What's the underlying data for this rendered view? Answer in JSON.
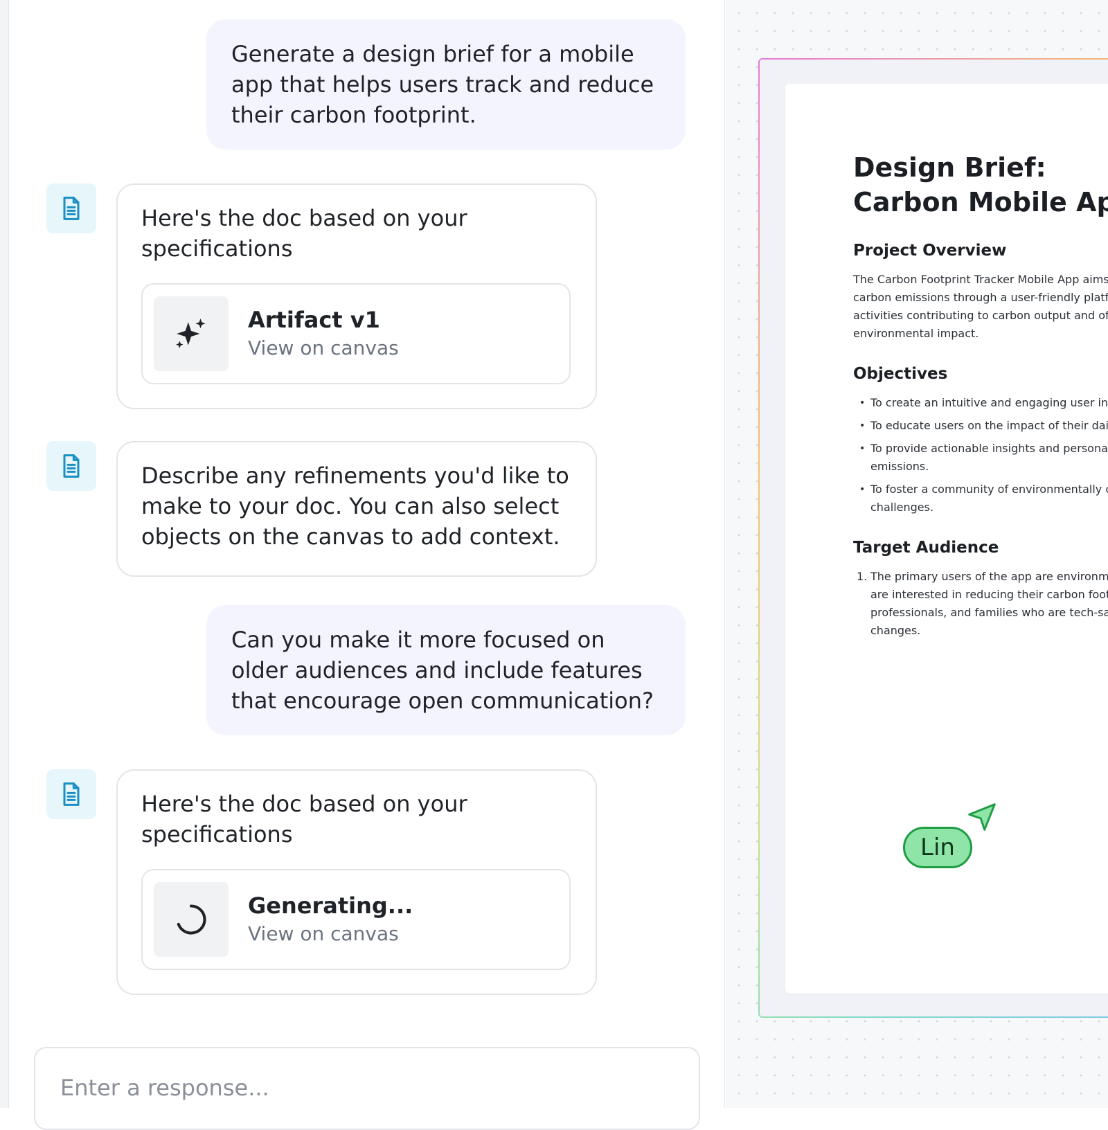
{
  "chat": {
    "messages": [
      {
        "role": "user",
        "text": "Generate a design brief for a mobile app that helps users track and reduce their carbon footprint."
      },
      {
        "role": "assistant",
        "icon": "document-icon",
        "text": "Here's the doc based on your specifications",
        "artifact": {
          "icon": "sparkles-icon",
          "title": "Artifact v1",
          "link": "View on canvas"
        }
      },
      {
        "role": "assistant",
        "icon": "document-icon",
        "text": "Describe any refinements you'd like to make to your doc. You can also select objects on the canvas to add context."
      },
      {
        "role": "user",
        "text": "Can you make it more focused on older audiences and include features that encourage open communication?"
      },
      {
        "role": "assistant",
        "icon": "document-icon",
        "text": "Here's the doc based on your specifications",
        "artifact": {
          "icon": "loading-spinner-icon",
          "title": "Generating...",
          "link": "View on canvas"
        }
      }
    ],
    "composer": {
      "placeholder": "Enter a response..."
    }
  },
  "canvas": {
    "doc": {
      "title": "Design Brief: Carbon Mobile App",
      "sections": {
        "overview": {
          "heading": "Project Overview",
          "lines": [
            "The Carbon Footprint Tracker Mobile App aims",
            "carbon emissions through a user-friendly platfo",
            "activities contributing to carbon output and offe",
            "environmental impact."
          ]
        },
        "objectives": {
          "heading": "Objectives",
          "items": [
            [
              "To create an intuitive and engaging user inte"
            ],
            [
              "To educate users on the impact of their daily"
            ],
            [
              "To provide actionable insights and personali",
              "emissions."
            ],
            [
              "To foster a community of environmentally co",
              "challenges."
            ]
          ]
        },
        "audience": {
          "heading": "Target Audience",
          "number": "1.",
          "lines": [
            "The primary users of the app are environme",
            "are interested in reducing their carbon footp",
            "professionals, and families who are tech-sav",
            "changes."
          ]
        }
      }
    },
    "collaborator": {
      "name": "Lin",
      "color": "#8fe5a7",
      "border_color": "#1f9d44"
    }
  }
}
